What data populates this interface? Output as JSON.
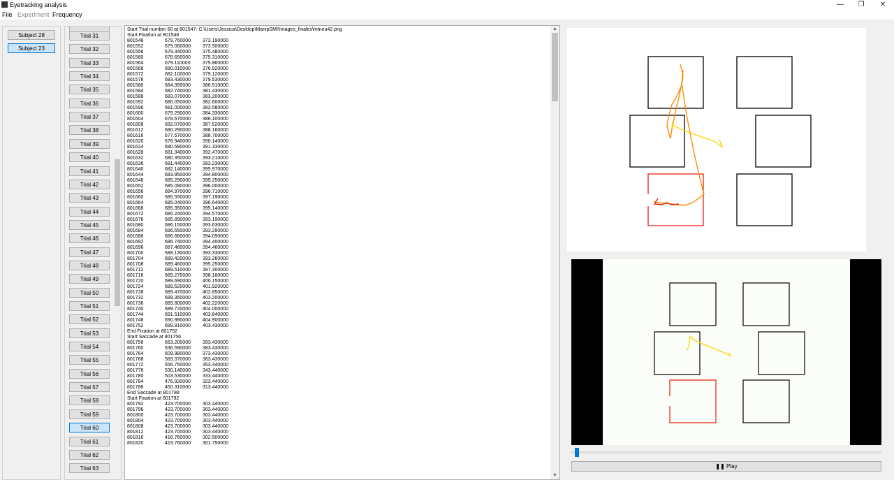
{
  "window": {
    "title": "Eyetracking analysis",
    "controls": {
      "minimize": "—",
      "maximize": "❐",
      "close": "✕"
    }
  },
  "menu": [
    {
      "label": "File",
      "enabled": true
    },
    {
      "label": "Experiment",
      "enabled": false
    },
    {
      "label": "Frequency",
      "enabled": true
    }
  ],
  "subjects": {
    "items": [
      "Subject 28",
      "Subject 23"
    ],
    "selected": "Subject 23"
  },
  "trials": {
    "items": [
      "Trial 31",
      "Trial 32",
      "Trial 33",
      "Trial 34",
      "Trial 35",
      "Trial 36",
      "Trial 37",
      "Trial 38",
      "Trial 39",
      "Trial 40",
      "Trial 41",
      "Trial 42",
      "Trial 43",
      "Trial 44",
      "Trial 45",
      "Trial 46",
      "Trial 47",
      "Trial 48",
      "Trial 49",
      "Trial 50",
      "Trial 51",
      "Trial 52",
      "Trial 53",
      "Trial 54",
      "Trial 55",
      "Trial 56",
      "Trial 57",
      "Trial 58",
      "Trial 59",
      "Trial 60",
      "Trial 61",
      "Trial 62",
      "Trial 63"
    ],
    "selected": "Trial 60"
  },
  "log": {
    "lines": [
      "Start Trial number 60 at 801547: C:\\Users\\Jessica\\Desktop\\ManipSMI\\Images_finales\\mtneu42.png",
      "Start Fixation at 801548",
      [
        "801548",
        "679.760000",
        "373.190000"
      ],
      [
        "801552",
        "679.060000",
        "373.500000"
      ],
      [
        "801556",
        "679.340000",
        "375.480000"
      ],
      [
        "801560",
        "678.650000",
        "375.310000"
      ],
      [
        "801564",
        "679.110000",
        "375.860000"
      ],
      [
        "801568",
        "680.010000",
        "376.920000"
      ],
      [
        "801572",
        "682.100000",
        "379.120000"
      ],
      [
        "801576",
        "683.430000",
        "379.530000"
      ],
      [
        "801580",
        "684.350000",
        "380.510000"
      ],
      [
        "801584",
        "682.740000",
        "381.430000"
      ],
      [
        "801588",
        "683.070000",
        "383.200000"
      ],
      [
        "801592",
        "680.050000",
        "382.600000"
      ],
      [
        "801596",
        "681.000000",
        "383.580000"
      ],
      [
        "801600",
        "679.290000",
        "384.330000"
      ],
      [
        "801604",
        "678.670000",
        "386.100000"
      ],
      [
        "801608",
        "682.070000",
        "387.520000"
      ],
      [
        "801612",
        "680.290000",
        "388.160000"
      ],
      [
        "801616",
        "677.570000",
        "388.700000"
      ],
      [
        "801620",
        "678.940000",
        "390.140000"
      ],
      [
        "801624",
        "680.580000",
        "391.330000"
      ],
      [
        "801628",
        "681.340000",
        "392.470000"
      ],
      [
        "801632",
        "680.350000",
        "393.210000"
      ],
      [
        "801636",
        "681.440000",
        "393.230000"
      ],
      [
        "801640",
        "682.140000",
        "395.970000"
      ],
      [
        "801644",
        "683.950000",
        "394.800000"
      ],
      [
        "801648",
        "685.290000",
        "395.250000"
      ],
      [
        "801652",
        "685.090000",
        "396.000000"
      ],
      [
        "801656",
        "684.970000",
        "396.710000"
      ],
      [
        "801660",
        "685.550000",
        "397.190000"
      ],
      [
        "801664",
        "685.040000",
        "396.640000"
      ],
      [
        "801668",
        "685.350000",
        "395.140000"
      ],
      [
        "801672",
        "685.240000",
        "394.570000"
      ],
      [
        "801676",
        "685.890000",
        "393.190000"
      ],
      [
        "801680",
        "686.150000",
        "393.630000"
      ],
      [
        "801684",
        "686.550000",
        "393.290000"
      ],
      [
        "801688",
        "686.680000",
        "394.090000"
      ],
      [
        "801692",
        "686.740000",
        "394.400000"
      ],
      [
        "801696",
        "687.460000",
        "394.460000"
      ],
      [
        "801700",
        "688.130000",
        "393.330000"
      ],
      [
        "801704",
        "689.420000",
        "393.260000"
      ],
      [
        "801708",
        "689.460000",
        "395.250000"
      ],
      [
        "801712",
        "689.510000",
        "397.300000"
      ],
      [
        "801716",
        "689.270000",
        "398.180000"
      ],
      [
        "801720",
        "689.690000",
        "400.150000"
      ],
      [
        "801724",
        "689.520000",
        "401.920000"
      ],
      [
        "801728",
        "689.470000",
        "402.850000"
      ],
      [
        "801732",
        "689.350000",
        "403.200000"
      ],
      [
        "801736",
        "689.800000",
        "402.220000"
      ],
      [
        "801740",
        "689.720000",
        "404.000000"
      ],
      [
        "801744",
        "691.510000",
        "403.840000"
      ],
      [
        "801748",
        "690.980000",
        "404.900000"
      ],
      [
        "801752",
        "689.810000",
        "403.430000"
      ],
      "End Fixation at 801752",
      "Start Saccade at 801756",
      [
        "801756",
        "663.200000",
        "393.430000"
      ],
      [
        "801760",
        "636.590000",
        "383.430000"
      ],
      [
        "801764",
        "609.980000",
        "373.430000"
      ],
      [
        "801768",
        "583.370000",
        "363.430000"
      ],
      [
        "801772",
        "556.750000",
        "353.440000"
      ],
      [
        "801776",
        "530.140000",
        "343.440000"
      ],
      [
        "801780",
        "503.530000",
        "333.440000"
      ],
      [
        "801784",
        "476.920000",
        "323.440000"
      ],
      [
        "801788",
        "450.310000",
        "313.440000"
      ],
      "End Saccade at 801788",
      "Start Fixation at 801792",
      [
        "801792",
        "423.700000",
        "303.440000"
      ],
      [
        "801796",
        "423.700000",
        "303.440000"
      ],
      [
        "801800",
        "423.700000",
        "303.440000"
      ],
      [
        "801804",
        "423.700000",
        "303.440000"
      ],
      [
        "801808",
        "423.700000",
        "303.440000"
      ],
      [
        "801812",
        "423.700000",
        "303.440000"
      ],
      [
        "801816",
        "416.760000",
        "302.500000"
      ],
      [
        "801820",
        "419.760000",
        "301.750000"
      ]
    ]
  },
  "colors": {
    "fixation_path": "#ffd700",
    "saccade_path": "#ff8c00",
    "target_box": "#e8200c",
    "selection_bg": "#cce4f7",
    "selection_border": "#0078d7"
  },
  "player": {
    "play_label": "Play",
    "play_icon": "pause-icon",
    "progress": 0.01
  }
}
